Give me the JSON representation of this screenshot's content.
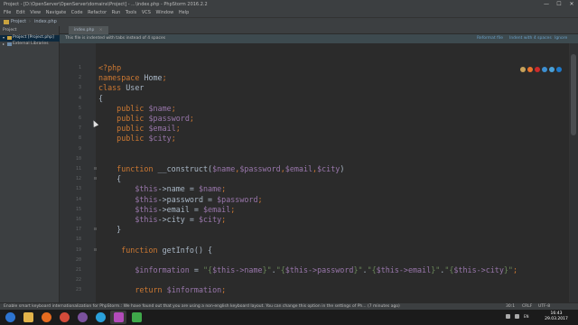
{
  "window": {
    "title": "Project - [D:\\OpenServer\\OpenServer\\domains\\Project] - ...\\index.php - PhpStorm 2016.2.2",
    "minimize": "—",
    "maximize": "☐",
    "close": "✕"
  },
  "menu": [
    "File",
    "Edit",
    "View",
    "Navigate",
    "Code",
    "Refactor",
    "Run",
    "Tools",
    "VCS",
    "Window",
    "Help"
  ],
  "navbar": {
    "project": "Project",
    "file": "index.php"
  },
  "sidebar": {
    "header": "Project",
    "root": "Project [Project.php]",
    "root_path": "D:\\OpenServer\\OpenServer\\domains\\Project",
    "ext": "External Libraries"
  },
  "tab": {
    "label": "index.php"
  },
  "notification": {
    "message": "This file is indented with tabs instead of 4 spaces",
    "action1": "Reformat file",
    "action2": "Indent with 4 spaces",
    "action3": "Ignore"
  },
  "code": {
    "lines": [
      "<?php",
      "namespace Home;",
      "class User",
      "{",
      "    public $name;",
      "    public $password;",
      "    public $email;",
      "    public $city;",
      "",
      "",
      "    function __construct($name,$password,$email,$city)",
      "    {",
      "        $this->name = $name;",
      "        $this->password = $password;",
      "        $this->email = $email;",
      "        $this->city = $city;",
      "    }",
      "",
      "     function getInfo() {",
      "",
      "        $information = \"{$this->name}\".\"{$this->password}\".\"{$this->email}\".\"{$this->city}\";",
      "",
      "        return $information;"
    ],
    "line_numbers": [
      "1",
      "2",
      "3",
      "4",
      "5",
      "6",
      "7",
      "8",
      "9",
      "10",
      "11",
      "12",
      "13",
      "14",
      "15",
      "16",
      "17",
      "18",
      "19",
      "20",
      "21",
      "22",
      "23"
    ]
  },
  "status": {
    "message": "Enable smart keyboard internationalization for PhpStorm.: We have found out that you are using a non-english keyboard layout. You can change this option in the settings of Ph... (7 minutes ago)",
    "position": "30:1",
    "encoding": "CRLF",
    "charset": "UTF-8"
  },
  "clock": {
    "time": "16:43",
    "date": "29.03.2017"
  },
  "colors": {
    "keyword": "#cc7832",
    "variable": "#9876aa",
    "string": "#6a8759",
    "plain": "#a9b7c6",
    "php_tag": "#cc7832"
  }
}
